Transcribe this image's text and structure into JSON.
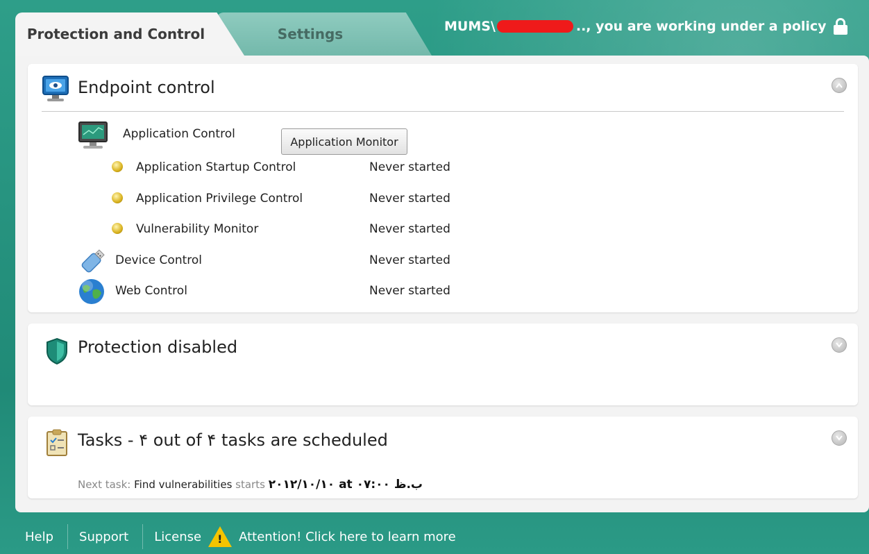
{
  "tabs": [
    {
      "label": "Protection and Control",
      "active": true
    },
    {
      "label": "Settings",
      "active": false
    }
  ],
  "user": {
    "prefix": "MUMS\\",
    "suffix": ".., you are working under a policy",
    "redacted": true
  },
  "endpoint": {
    "title": "Endpoint control",
    "application_control": {
      "label": "Application Control",
      "button": "Application Monitor",
      "items": [
        {
          "label": "Application Startup Control",
          "status": "Never started"
        },
        {
          "label": "Application Privilege Control",
          "status": "Never started"
        },
        {
          "label": "Vulnerability Monitor",
          "status": "Never started"
        }
      ]
    },
    "device_control": {
      "label": "Device Control",
      "status": "Never started"
    },
    "web_control": {
      "label": "Web Control",
      "status": "Never started"
    }
  },
  "protection": {
    "title": "Protection disabled"
  },
  "tasks": {
    "title": "Tasks - ۴ out of ۴ tasks are scheduled",
    "next_task_label": "Next task:",
    "next_task_name": "Find vulnerabilities",
    "starts_label": "starts",
    "start_time": "۲۰۱۲/۱۰/۱۰ at ۰۷:۰۰ ب.ظ"
  },
  "footer": {
    "help": "Help",
    "support": "Support",
    "license": "License",
    "attention": "Attention! Click here to learn more"
  },
  "colors": {
    "accent": "#2e9e89",
    "status_dot": "#d9b21e",
    "redaction": "#ef1a1a"
  },
  "icons": [
    "monitor-eye-icon",
    "monitor-icon",
    "status-dot-icon",
    "usb-drive-icon",
    "globe-icon",
    "shield-icon",
    "clipboard-icon",
    "collapse-icon",
    "expand-icon",
    "lock-icon",
    "warning-icon"
  ]
}
